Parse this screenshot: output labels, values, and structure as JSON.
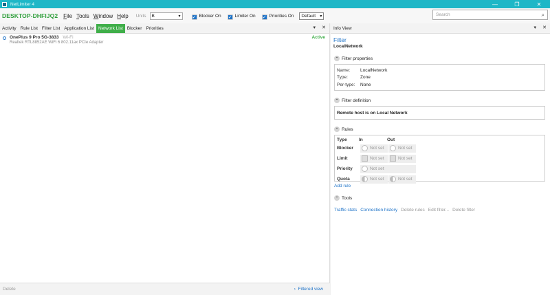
{
  "window": {
    "title": "NetLimiter 4",
    "minimize": "—",
    "maximize": "❐",
    "close": "✕"
  },
  "toolbar": {
    "hostname": "DESKTOP-DHFIJQ2",
    "menu": [
      "File",
      "Tools",
      "Window",
      "Help"
    ],
    "units_label": "Units",
    "units_value": "B",
    "blocker_label": "Blocker On",
    "limiter_label": "Limiter On",
    "priorities_label": "Priorities On",
    "profile_value": "Default",
    "search_placeholder": "Search",
    "check_mark": "✓",
    "select_chevron": "▾",
    "search_glyph": "⌕"
  },
  "left": {
    "tabs": [
      "Activity",
      "Rule List",
      "Filter List",
      "Application List",
      "Network List",
      "Blocker",
      "Priorities"
    ],
    "active_tab": "Network List",
    "tab_menu": "▾",
    "tab_close": "✕",
    "rows": [
      {
        "name": "OnePlus 9 Pro 5G-3833",
        "type": "Wi-Fi",
        "adapter": "Realtek RTL8852AE WiFi 6 802.11ax PCIe Adapter",
        "status": "Active"
      }
    ],
    "footer_delete": "Delete",
    "footer_filtered": "Filtered view",
    "footer_arrow": "›"
  },
  "right": {
    "header": "Info View",
    "header_menu": "▾",
    "header_close": "✕",
    "filter_title": "Filter",
    "filter_name": "LocalNetwork",
    "section_glyph": "⌃",
    "props_heading": "Filter properties",
    "props": [
      {
        "key": "Name:",
        "value": "LocalNetwork"
      },
      {
        "key": "Type:",
        "value": "Zone"
      },
      {
        "key": "Per-type:",
        "value": "None"
      }
    ],
    "def_heading": "Filter definition",
    "definition": "Remote host is on Local Network",
    "rules_heading": "Rules",
    "rules_cols": [
      "Type",
      "In",
      "Out"
    ],
    "rules": [
      {
        "name": "Blocker",
        "in": "Not set",
        "out": "Not set"
      },
      {
        "name": "Limit",
        "in": "Not set",
        "out": "Not set"
      },
      {
        "name": "Priority",
        "in": "Not set",
        "out": ""
      },
      {
        "name": "Quota",
        "in": "Not set",
        "out": "Not set"
      }
    ],
    "add_rule": "Add rule",
    "tools_heading": "Tools",
    "tools": [
      "Traffic stats",
      "Connection history",
      "Delete rules",
      "Edit filter...",
      "Delete filter"
    ]
  },
  "colors": {
    "accent_green": "#3fae49",
    "link_blue": "#1e73c8",
    "titlebar": "#1fb7c7"
  }
}
